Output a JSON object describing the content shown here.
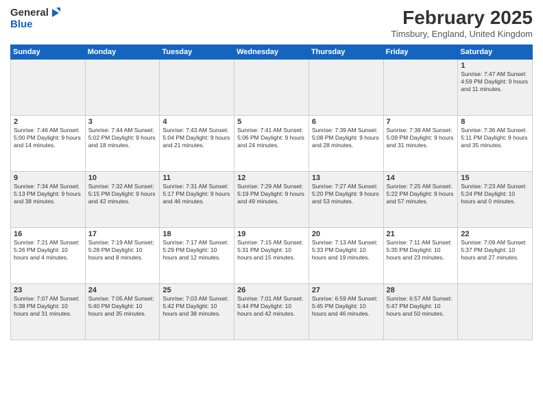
{
  "header": {
    "logo_general": "General",
    "logo_blue": "Blue",
    "month_title": "February 2025",
    "location": "Timsbury, England, United Kingdom"
  },
  "days_of_week": [
    "Sunday",
    "Monday",
    "Tuesday",
    "Wednesday",
    "Thursday",
    "Friday",
    "Saturday"
  ],
  "weeks": [
    [
      {
        "day": "",
        "info": ""
      },
      {
        "day": "",
        "info": ""
      },
      {
        "day": "",
        "info": ""
      },
      {
        "day": "",
        "info": ""
      },
      {
        "day": "",
        "info": ""
      },
      {
        "day": "",
        "info": ""
      },
      {
        "day": "1",
        "info": "Sunrise: 7:47 AM\nSunset: 4:59 PM\nDaylight: 9 hours and 11 minutes."
      }
    ],
    [
      {
        "day": "2",
        "info": "Sunrise: 7:46 AM\nSunset: 5:00 PM\nDaylight: 9 hours and 14 minutes."
      },
      {
        "day": "3",
        "info": "Sunrise: 7:44 AM\nSunset: 5:02 PM\nDaylight: 9 hours and 18 minutes."
      },
      {
        "day": "4",
        "info": "Sunrise: 7:43 AM\nSunset: 5:04 PM\nDaylight: 9 hours and 21 minutes."
      },
      {
        "day": "5",
        "info": "Sunrise: 7:41 AM\nSunset: 5:06 PM\nDaylight: 9 hours and 24 minutes."
      },
      {
        "day": "6",
        "info": "Sunrise: 7:39 AM\nSunset: 5:08 PM\nDaylight: 9 hours and 28 minutes."
      },
      {
        "day": "7",
        "info": "Sunrise: 7:38 AM\nSunset: 5:09 PM\nDaylight: 9 hours and 31 minutes."
      },
      {
        "day": "8",
        "info": "Sunrise: 7:36 AM\nSunset: 5:11 PM\nDaylight: 9 hours and 35 minutes."
      }
    ],
    [
      {
        "day": "9",
        "info": "Sunrise: 7:34 AM\nSunset: 5:13 PM\nDaylight: 9 hours and 38 minutes."
      },
      {
        "day": "10",
        "info": "Sunrise: 7:32 AM\nSunset: 5:15 PM\nDaylight: 9 hours and 42 minutes."
      },
      {
        "day": "11",
        "info": "Sunrise: 7:31 AM\nSunset: 5:17 PM\nDaylight: 9 hours and 46 minutes."
      },
      {
        "day": "12",
        "info": "Sunrise: 7:29 AM\nSunset: 5:19 PM\nDaylight: 9 hours and 49 minutes."
      },
      {
        "day": "13",
        "info": "Sunrise: 7:27 AM\nSunset: 5:20 PM\nDaylight: 9 hours and 53 minutes."
      },
      {
        "day": "14",
        "info": "Sunrise: 7:25 AM\nSunset: 5:22 PM\nDaylight: 9 hours and 57 minutes."
      },
      {
        "day": "15",
        "info": "Sunrise: 7:23 AM\nSunset: 5:24 PM\nDaylight: 10 hours and 0 minutes."
      }
    ],
    [
      {
        "day": "16",
        "info": "Sunrise: 7:21 AM\nSunset: 5:26 PM\nDaylight: 10 hours and 4 minutes."
      },
      {
        "day": "17",
        "info": "Sunrise: 7:19 AM\nSunset: 5:28 PM\nDaylight: 10 hours and 8 minutes."
      },
      {
        "day": "18",
        "info": "Sunrise: 7:17 AM\nSunset: 5:29 PM\nDaylight: 10 hours and 12 minutes."
      },
      {
        "day": "19",
        "info": "Sunrise: 7:15 AM\nSunset: 5:31 PM\nDaylight: 10 hours and 15 minutes."
      },
      {
        "day": "20",
        "info": "Sunrise: 7:13 AM\nSunset: 5:33 PM\nDaylight: 10 hours and 19 minutes."
      },
      {
        "day": "21",
        "info": "Sunrise: 7:11 AM\nSunset: 5:35 PM\nDaylight: 10 hours and 23 minutes."
      },
      {
        "day": "22",
        "info": "Sunrise: 7:09 AM\nSunset: 5:37 PM\nDaylight: 10 hours and 27 minutes."
      }
    ],
    [
      {
        "day": "23",
        "info": "Sunrise: 7:07 AM\nSunset: 5:38 PM\nDaylight: 10 hours and 31 minutes."
      },
      {
        "day": "24",
        "info": "Sunrise: 7:05 AM\nSunset: 5:40 PM\nDaylight: 10 hours and 35 minutes."
      },
      {
        "day": "25",
        "info": "Sunrise: 7:03 AM\nSunset: 5:42 PM\nDaylight: 10 hours and 38 minutes."
      },
      {
        "day": "26",
        "info": "Sunrise: 7:01 AM\nSunset: 5:44 PM\nDaylight: 10 hours and 42 minutes."
      },
      {
        "day": "27",
        "info": "Sunrise: 6:59 AM\nSunset: 5:45 PM\nDaylight: 10 hours and 46 minutes."
      },
      {
        "day": "28",
        "info": "Sunrise: 6:57 AM\nSunset: 5:47 PM\nDaylight: 10 hours and 50 minutes."
      },
      {
        "day": "",
        "info": ""
      }
    ]
  ],
  "gray_rows": [
    0,
    2,
    4
  ]
}
